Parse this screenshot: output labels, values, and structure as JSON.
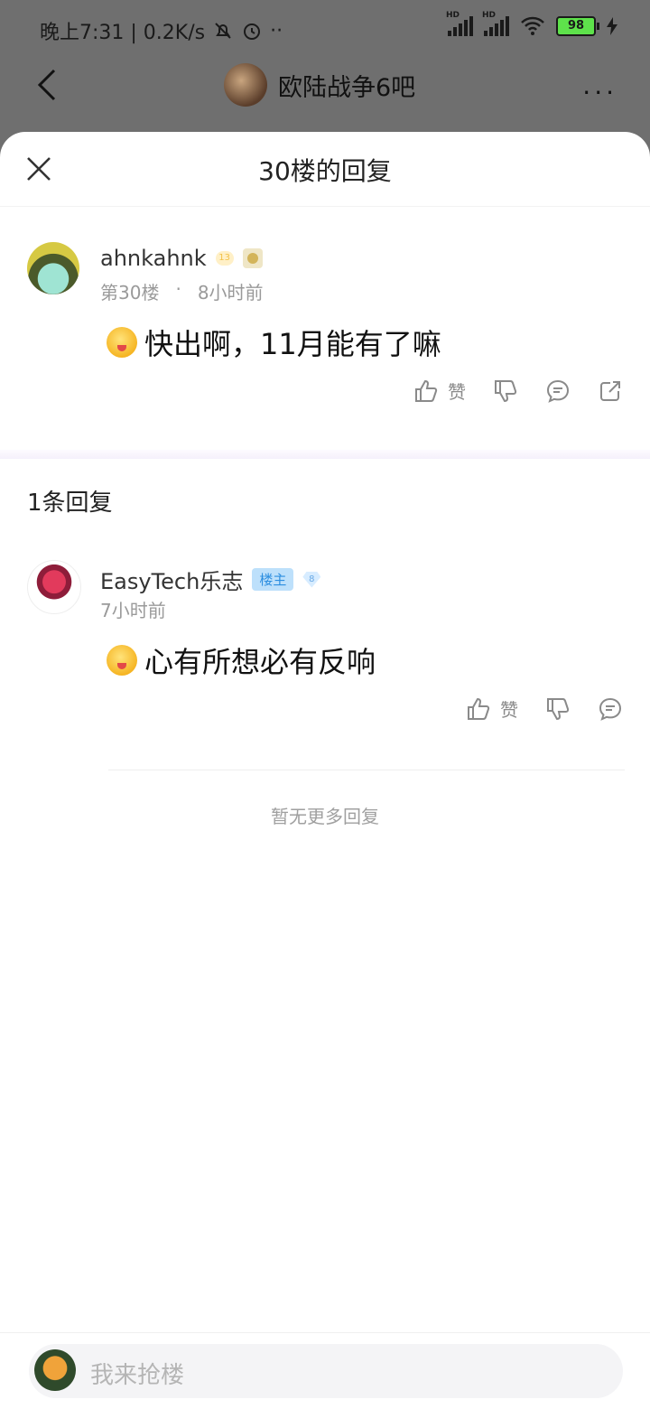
{
  "status_bar": {
    "time_text": "晚上7:31 | 0.2K/s",
    "battery": "98",
    "hd_label": "HD"
  },
  "topbar": {
    "forum_name": "欧陆战争6吧",
    "more_label": "···"
  },
  "sheet": {
    "title": "30楼的回复"
  },
  "post": {
    "username": "ahnkahnk",
    "level_badge": "13",
    "floor": "第30楼",
    "separator": "·",
    "time": "8小时前",
    "content": "快出啊，11月能有了嘛",
    "like_label": "赞"
  },
  "reply_section": {
    "count_label": "1条回复"
  },
  "reply": {
    "username": "EasyTech乐志",
    "owner_tag": "楼主",
    "level_badge": "8",
    "time": "7小时前",
    "content": "心有所想必有反响",
    "like_label": "赞"
  },
  "no_more_text": "暂无更多回复",
  "bottom": {
    "input_placeholder": "我来抢楼"
  },
  "colors": {
    "overlay": "#6f6f6f",
    "sheet_bg": "#ffffff",
    "owner_tag_bg": "#bde0fb",
    "owner_tag_text": "#2c8ee0",
    "meta_text": "#9a9a9a"
  }
}
